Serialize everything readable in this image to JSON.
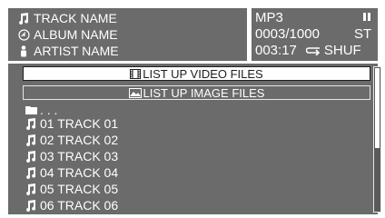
{
  "now_playing": {
    "track_name": "TRACK NAME",
    "album_name": "ALBUM NAME",
    "artist_name": "ARTIST NAME"
  },
  "status": {
    "format": "MP3",
    "track_counter": "0003/1000",
    "stereo": "ST",
    "elapsed_time": "003:17",
    "play_mode": "SHUF"
  },
  "list": {
    "video_button": "LIST UP VIDEO FILES",
    "image_button": "LIST UP IMAGE FILES",
    "parent_folder": ". . .",
    "tracks": [
      "01 TRACK 01",
      "02 TRACK 02",
      "03 TRACK 03",
      "04 TRACK 04",
      "05 TRACK 05",
      "06 TRACK 06"
    ]
  },
  "colors": {
    "panel": "#6b6b6b",
    "text": "#ffffff",
    "selected_bg": "#ffffff",
    "selected_text": "#1e1e1e"
  },
  "icons": {
    "track": "music-note-icon",
    "album": "disc-icon",
    "artist": "person-icon",
    "state": "pause-icon",
    "mode": "repeat-icon",
    "video": "film-icon",
    "image": "picture-icon",
    "folder": "folder-icon"
  }
}
